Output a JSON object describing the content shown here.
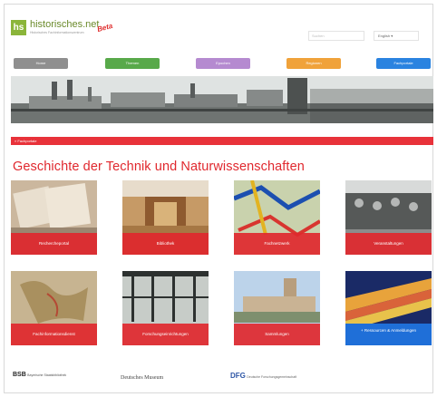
{
  "header": {
    "logo_letters": "hs",
    "logo_title": "historisches.net",
    "logo_tagline": "Historisches Fachinformationszentrum",
    "beta_label": "Beta",
    "search_placeholder": "Suchen",
    "language_label": "English ▾"
  },
  "nav": [
    {
      "label": "Home",
      "color": "#8f8f8f"
    },
    {
      "label": "Themen",
      "color": "#58a94a"
    },
    {
      "label": "Epochen",
      "color": "#b58ad0"
    },
    {
      "label": "Regionen",
      "color": "#f0a23a"
    },
    {
      "label": "Fachportale",
      "color": "#2a83e0"
    }
  ],
  "breadcrumb": "» Fachportale",
  "page_title": "Geschichte der Technik und Naturwissenschaften",
  "tiles": [
    {
      "label": "Rechercheportal",
      "icon": "card-catalog-icon"
    },
    {
      "label": "Bibliothek",
      "icon": "library-icon"
    },
    {
      "label": "Fachnetzwerk",
      "icon": "network-map-icon"
    },
    {
      "label": "Veranstaltungen",
      "icon": "audience-icon"
    },
    {
      "label": "Fachinformationsdienst",
      "icon": "old-map-icon"
    },
    {
      "label": "Forschungseinrichtungen",
      "icon": "greenhouse-icon"
    },
    {
      "label": "Sammlungen",
      "icon": "museum-building-icon"
    },
    {
      "label": "+ Ressourcen & Anmeldungen",
      "icon": "books-icon",
      "blue": true
    }
  ],
  "footer": {
    "logo1": "Bayerische Staatsbibliothek",
    "logo1_mark": "BSB",
    "logo2": "Deutsches Museum",
    "logo3_mark": "DFG",
    "logo3": "Deutsche Forschungsgemeinschaft"
  }
}
